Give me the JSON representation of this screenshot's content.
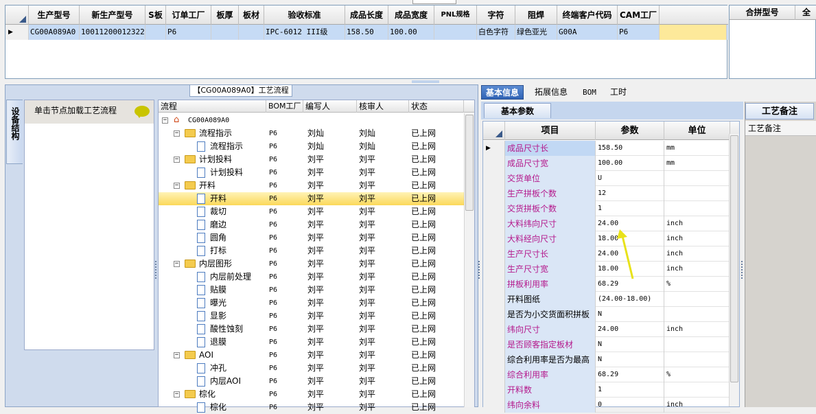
{
  "order_grid": {
    "columns": [
      "生产型号",
      "新生产型号",
      "S板",
      "订单工厂",
      "板厚",
      "板材",
      "验收标准",
      "成品长度",
      "成品宽度",
      "PNL规格",
      "字符",
      "阻焊",
      "终端客户代码",
      "CAM工厂"
    ],
    "row": {
      "production_model": "CG00A089A0",
      "new_production_model": "10011200012322",
      "s_board": "",
      "order_factory": "P6",
      "thickness": "",
      "material": "",
      "acceptance_standard": "IPC-6012 III级",
      "length": "158.50",
      "width": "100.00",
      "pnl_spec": "",
      "legend": "白色字符",
      "solder_mask": "绿色亚光",
      "customer_code": "G00A",
      "cam_factory": "P6"
    }
  },
  "panel_grid": {
    "columns": [
      "合拼型号",
      "全"
    ]
  },
  "process_title": "【CG00A089A0】工艺流程",
  "side_tab_label": "设备结构",
  "load_tip": "单击节点加载工艺流程",
  "tree": {
    "columns": [
      "流程",
      "BOM工厂",
      "编写人",
      "核审人",
      "状态"
    ],
    "root": "CG00A089A0",
    "rows": [
      {
        "name": "流程指示",
        "factory": "P6",
        "writer": "刘灿",
        "reviewer": "刘灿",
        "status": "已上网"
      },
      {
        "name": "流程指示",
        "factory": "P6",
        "writer": "刘灿",
        "reviewer": "刘灿",
        "status": "已上网"
      },
      {
        "name": "计划投料",
        "factory": "P6",
        "writer": "刘平",
        "reviewer": "刘平",
        "status": "已上网"
      },
      {
        "name": "计划投料",
        "factory": "P6",
        "writer": "刘平",
        "reviewer": "刘平",
        "status": "已上网"
      },
      {
        "name": "开料",
        "factory": "P6",
        "writer": "刘平",
        "reviewer": "刘平",
        "status": "已上网"
      },
      {
        "name": "开料",
        "factory": "P6",
        "writer": "刘平",
        "reviewer": "刘平",
        "status": "已上网"
      },
      {
        "name": "裁切",
        "factory": "P6",
        "writer": "刘平",
        "reviewer": "刘平",
        "status": "已上网"
      },
      {
        "name": "磨边",
        "factory": "P6",
        "writer": "刘平",
        "reviewer": "刘平",
        "status": "已上网"
      },
      {
        "name": "圆角",
        "factory": "P6",
        "writer": "刘平",
        "reviewer": "刘平",
        "status": "已上网"
      },
      {
        "name": "打标",
        "factory": "P6",
        "writer": "刘平",
        "reviewer": "刘平",
        "status": "已上网"
      },
      {
        "name": "内层图形",
        "factory": "P6",
        "writer": "刘平",
        "reviewer": "刘平",
        "status": "已上网"
      },
      {
        "name": "内层前处理",
        "factory": "P6",
        "writer": "刘平",
        "reviewer": "刘平",
        "status": "已上网"
      },
      {
        "name": "贴膜",
        "factory": "P6",
        "writer": "刘平",
        "reviewer": "刘平",
        "status": "已上网"
      },
      {
        "name": "曝光",
        "factory": "P6",
        "writer": "刘平",
        "reviewer": "刘平",
        "status": "已上网"
      },
      {
        "name": "显影",
        "factory": "P6",
        "writer": "刘平",
        "reviewer": "刘平",
        "status": "已上网"
      },
      {
        "name": "酸性蚀刻",
        "factory": "P6",
        "writer": "刘平",
        "reviewer": "刘平",
        "status": "已上网"
      },
      {
        "name": "退膜",
        "factory": "P6",
        "writer": "刘平",
        "reviewer": "刘平",
        "status": "已上网"
      },
      {
        "name": "AOI",
        "factory": "P6",
        "writer": "刘平",
        "reviewer": "刘平",
        "status": "已上网"
      },
      {
        "name": "冲孔",
        "factory": "P6",
        "writer": "刘平",
        "reviewer": "刘平",
        "status": "已上网"
      },
      {
        "name": "内层AOI",
        "factory": "P6",
        "writer": "刘平",
        "reviewer": "刘平",
        "status": "已上网"
      },
      {
        "name": "棕化",
        "factory": "P6",
        "writer": "刘平",
        "reviewer": "刘平",
        "status": "已上网"
      },
      {
        "name": "棕化",
        "factory": "P6",
        "writer": "刘平",
        "reviewer": "刘平",
        "status": "已上网"
      }
    ]
  },
  "tabs": [
    "基本信息",
    "拓展信息",
    "BOM",
    "工时"
  ],
  "basic_params_label": "基本参数",
  "params": {
    "columns": [
      "项目",
      "参数",
      "单位"
    ],
    "rows": [
      {
        "item": "成品尺寸长",
        "value": "158.50",
        "unit": "mm"
      },
      {
        "item": "成品尺寸宽",
        "value": "100.00",
        "unit": "mm"
      },
      {
        "item": "交货单位",
        "value": "U",
        "unit": ""
      },
      {
        "item": "生产拼板个数",
        "value": "12",
        "unit": ""
      },
      {
        "item": "交货拼板个数",
        "value": "1",
        "unit": ""
      },
      {
        "item": "大料纬向尺寸",
        "value": "24.00",
        "unit": "inch"
      },
      {
        "item": "大料经向尺寸",
        "value": "18.00",
        "unit": "inch"
      },
      {
        "item": "生产尺寸长",
        "value": "24.00",
        "unit": "inch"
      },
      {
        "item": "生产尺寸宽",
        "value": "18.00",
        "unit": "inch"
      },
      {
        "item": "拼板利用率",
        "value": "68.29",
        "unit": "%"
      },
      {
        "item": "开料图纸",
        "value": "(24.00-18.00)",
        "unit": ""
      },
      {
        "item": "是否为小交货面积拼板",
        "value": "N",
        "unit": ""
      },
      {
        "item": "纬向尺寸",
        "value": "24.00",
        "unit": "inch"
      },
      {
        "item": "是否顾客指定板材",
        "value": "N",
        "unit": ""
      },
      {
        "item": "综合利用率是否为最高",
        "value": "N",
        "unit": ""
      },
      {
        "item": "综合利用率",
        "value": "68.29",
        "unit": "%"
      },
      {
        "item": "开料数",
        "value": "1",
        "unit": ""
      },
      {
        "item": "纬向余料",
        "value": "0",
        "unit": "inch"
      }
    ]
  },
  "notes": {
    "tab_label": "工艺备注",
    "header": "工艺备注"
  }
}
